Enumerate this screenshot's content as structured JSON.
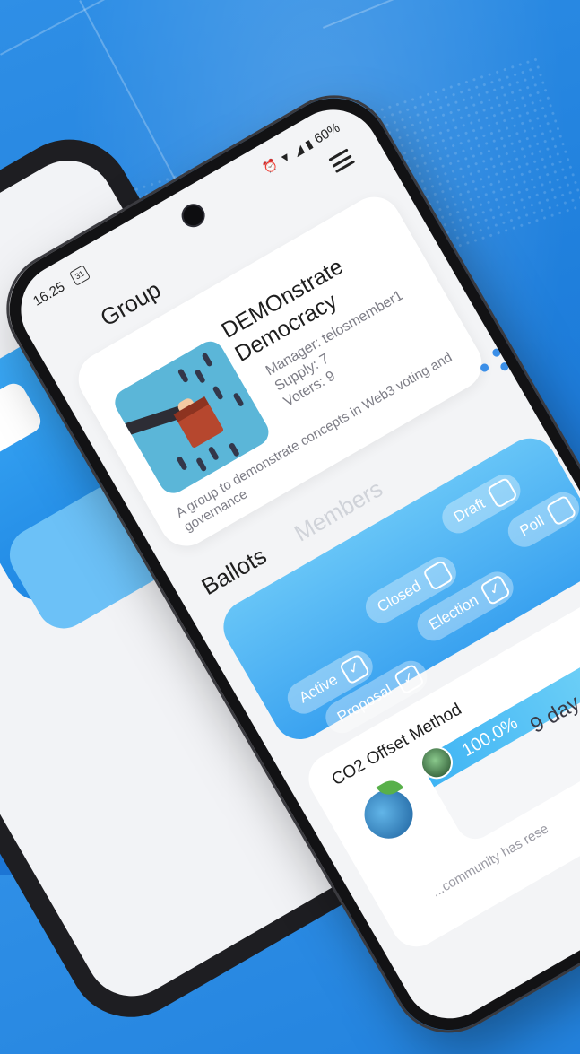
{
  "status_bar": {
    "time": "16:25",
    "notification": "31",
    "battery": "60%"
  },
  "header": {
    "title": "Group"
  },
  "group": {
    "name": "DEMOnstrate Democracy",
    "manager": "Manager: telosmember1",
    "supply": "Supply: 7",
    "voters": "Voters: 9",
    "description": "A group to demonstrate concepts in Web3 voting and governance"
  },
  "tabs": {
    "ballots": "Ballots",
    "members": "Members"
  },
  "filters": [
    {
      "label": "Active",
      "checked": true
    },
    {
      "label": "Closed",
      "checked": false
    },
    {
      "label": "Draft",
      "checked": false
    },
    {
      "label": "Proposal",
      "checked": true
    },
    {
      "label": "Election",
      "checked": true
    },
    {
      "label": "Poll",
      "checked": false
    }
  ],
  "ballot": {
    "title": "CO2 Offset Method",
    "progress": "100.0%",
    "progress_fraction": 1.0,
    "days": "9 day",
    "description": "...community has rese"
  },
  "colors": {
    "accent": "#3aa2f0",
    "background": "#1f7fdc"
  }
}
